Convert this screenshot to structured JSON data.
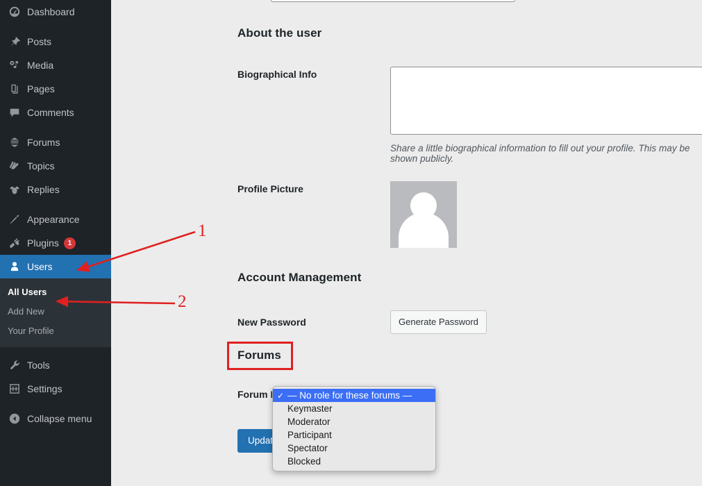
{
  "sidebar": {
    "items": [
      {
        "label": "Dashboard",
        "icon": "dashboard-icon",
        "gap_before": false
      },
      {
        "label": "Posts",
        "icon": "pin-icon",
        "gap_before": true
      },
      {
        "label": "Media",
        "icon": "media-icon",
        "gap_before": false
      },
      {
        "label": "Pages",
        "icon": "pages-icon",
        "gap_before": false
      },
      {
        "label": "Comments",
        "icon": "comment-icon",
        "gap_before": false
      },
      {
        "label": "Forums",
        "icon": "forums-icon",
        "gap_before": true
      },
      {
        "label": "Topics",
        "icon": "topics-icon",
        "gap_before": false
      },
      {
        "label": "Replies",
        "icon": "replies-icon",
        "gap_before": false
      },
      {
        "label": "Appearance",
        "icon": "brush-icon",
        "gap_before": true
      },
      {
        "label": "Plugins",
        "icon": "plug-icon",
        "badge": "1",
        "gap_before": false
      },
      {
        "label": "Users",
        "icon": "user-icon",
        "active": true,
        "gap_before": false
      }
    ],
    "submenu": [
      {
        "label": "All Users",
        "current": true
      },
      {
        "label": "Add New",
        "current": false
      },
      {
        "label": "Your Profile",
        "current": false
      }
    ],
    "items_after": [
      {
        "label": "Tools",
        "icon": "wrench-icon",
        "gap_before": true
      },
      {
        "label": "Settings",
        "icon": "settings-icon",
        "gap_before": false
      },
      {
        "label": "Collapse menu",
        "icon": "collapse-icon",
        "gap_before": true
      }
    ],
    "active_color": "#2271b1",
    "badge_color": "#d63638",
    "background": "#1d2327",
    "submenu_background": "#2c3338"
  },
  "main": {
    "about_heading": "About the user",
    "bio_label": "Biographical Info",
    "bio_value": "",
    "bio_help": "Share a little biographical information to fill out your profile. This may be shown publicly.",
    "profile_picture_label": "Profile Picture",
    "account_heading": "Account Management",
    "new_password_label": "New Password",
    "generate_password_label": "Generate Password",
    "forums_heading": "Forums",
    "forum_role_label": "Forum Role",
    "update_user_label": "Update User"
  },
  "forum_role_select": {
    "selected": "— No role for these forums —",
    "check_glyph": "✓",
    "options": [
      "— No role for these forums —",
      "Keymaster",
      "Moderator",
      "Participant",
      "Spectator",
      "Blocked"
    ],
    "highlight_color": "#3b6ef5"
  },
  "annotations": {
    "color": "#e02020",
    "marks": [
      {
        "number": "1",
        "points_to": "Users"
      },
      {
        "number": "2",
        "points_to": "All Users"
      }
    ],
    "highlight_box_target": "Forums"
  }
}
